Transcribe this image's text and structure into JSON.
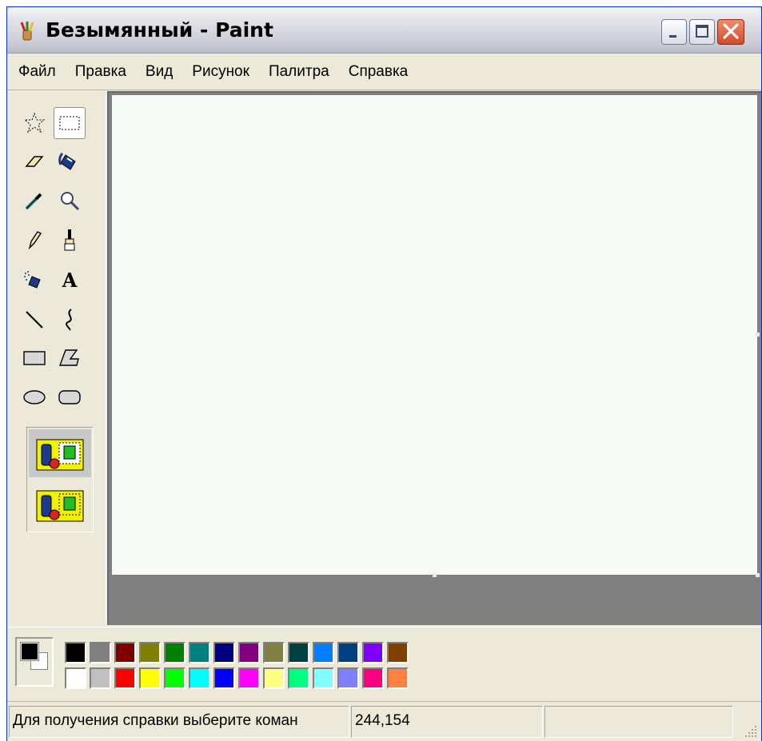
{
  "window": {
    "title": "Безымянный - Paint",
    "app_icon": "paint-brush-icon",
    "controls": [
      "minimize-icon",
      "maximize-icon",
      "close-icon"
    ]
  },
  "menu": {
    "items": [
      {
        "label": "Файл"
      },
      {
        "label": "Правка"
      },
      {
        "label": "Вид"
      },
      {
        "label": "Рисунок"
      },
      {
        "label": "Палитра"
      },
      {
        "label": "Справка"
      }
    ]
  },
  "tools": [
    {
      "name": "free-form-select-icon"
    },
    {
      "name": "rectangle-select-icon",
      "selected": true
    },
    {
      "name": "eraser-icon"
    },
    {
      "name": "fill-bucket-icon"
    },
    {
      "name": "color-picker-icon"
    },
    {
      "name": "magnifier-icon"
    },
    {
      "name": "pencil-icon"
    },
    {
      "name": "brush-icon"
    },
    {
      "name": "airbrush-icon"
    },
    {
      "name": "text-icon",
      "glyph": "A"
    },
    {
      "name": "line-icon"
    },
    {
      "name": "curve-icon"
    },
    {
      "name": "rectangle-icon"
    },
    {
      "name": "polygon-icon"
    },
    {
      "name": "ellipse-icon"
    },
    {
      "name": "rounded-rectangle-icon"
    }
  ],
  "selection_options": [
    {
      "name": "opaque-selection-icon",
      "selected": true
    },
    {
      "name": "transparent-selection-icon",
      "selected": false
    }
  ],
  "colors": {
    "foreground": "#000000",
    "background": "#ffffff",
    "palette_top": [
      "#000000",
      "#808080",
      "#800000",
      "#808000",
      "#008000",
      "#008080",
      "#000080",
      "#800080",
      "#808040",
      "#004040",
      "#0080ff",
      "#004080",
      "#8000ff",
      "#804000"
    ],
    "palette_bottom": [
      "#ffffff",
      "#c0c0c0",
      "#ff0000",
      "#ffff00",
      "#00ff00",
      "#00ffff",
      "#0000ff",
      "#ff00ff",
      "#ffff80",
      "#00ff80",
      "#80ffff",
      "#8080ff",
      "#ff0080",
      "#ff8040"
    ]
  },
  "status": {
    "help_text": "Для получения справки выберите коман",
    "coordinates": "244,154",
    "size_text": ""
  }
}
